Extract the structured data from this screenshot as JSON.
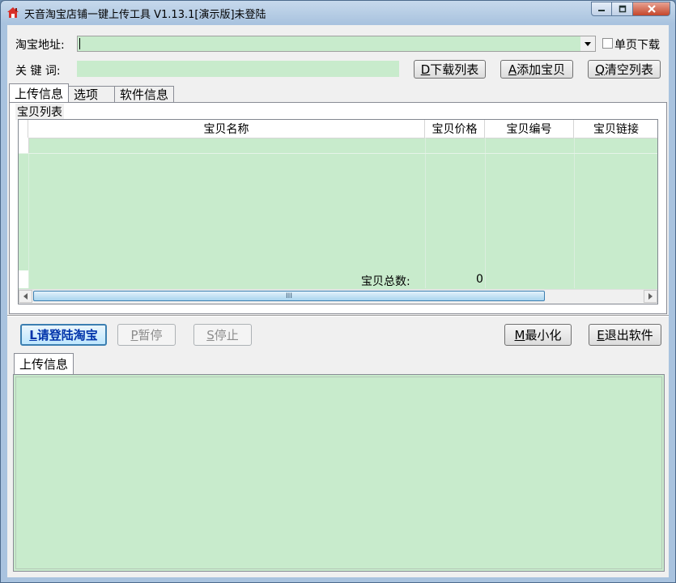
{
  "window": {
    "title": "天音淘宝店铺一键上传工具 V1.13.1[演示版]未登陆",
    "controls": {
      "minimize": "minimize-icon",
      "maximize": "maximize-icon",
      "close": "close-icon"
    },
    "colors": {
      "frame": "#a9c3df",
      "field_bg": "#c8ebcc",
      "close": "#c4462b"
    }
  },
  "form": {
    "url_label": "淘宝地址:",
    "url_value": "",
    "single_page_label": "单页下载",
    "single_page_checked": false,
    "keyword_label": "关 键 词:",
    "keyword_value": ""
  },
  "top_buttons": [
    {
      "key": "D",
      "label": "下载列表"
    },
    {
      "key": "A",
      "label": "添加宝贝"
    },
    {
      "key": "Q",
      "label": "清空列表"
    }
  ],
  "tabs": [
    {
      "label": "上传信息",
      "active": true
    },
    {
      "label": "选项",
      "active": false
    },
    {
      "label": "软件信息",
      "active": false
    }
  ],
  "product_list": {
    "group_title": "宝贝列表",
    "columns": [
      "宝贝名称",
      "宝贝价格",
      "宝贝编号",
      "宝贝链接"
    ],
    "rows": [],
    "total_label": "宝贝总数:",
    "total_value": "0",
    "scroll_thumb_glyph": "III"
  },
  "action_buttons": {
    "login": {
      "key": "L",
      "label": "请登陆淘宝"
    },
    "pause": {
      "key": "P",
      "label": "暂停"
    },
    "stop": {
      "key": "S",
      "label": "停止"
    },
    "minimize": {
      "key": "M",
      "label": "最小化"
    },
    "exit": {
      "key": "E",
      "label": "退出软件"
    }
  },
  "log_panel": {
    "tab_label": "上传信息",
    "content": ""
  }
}
